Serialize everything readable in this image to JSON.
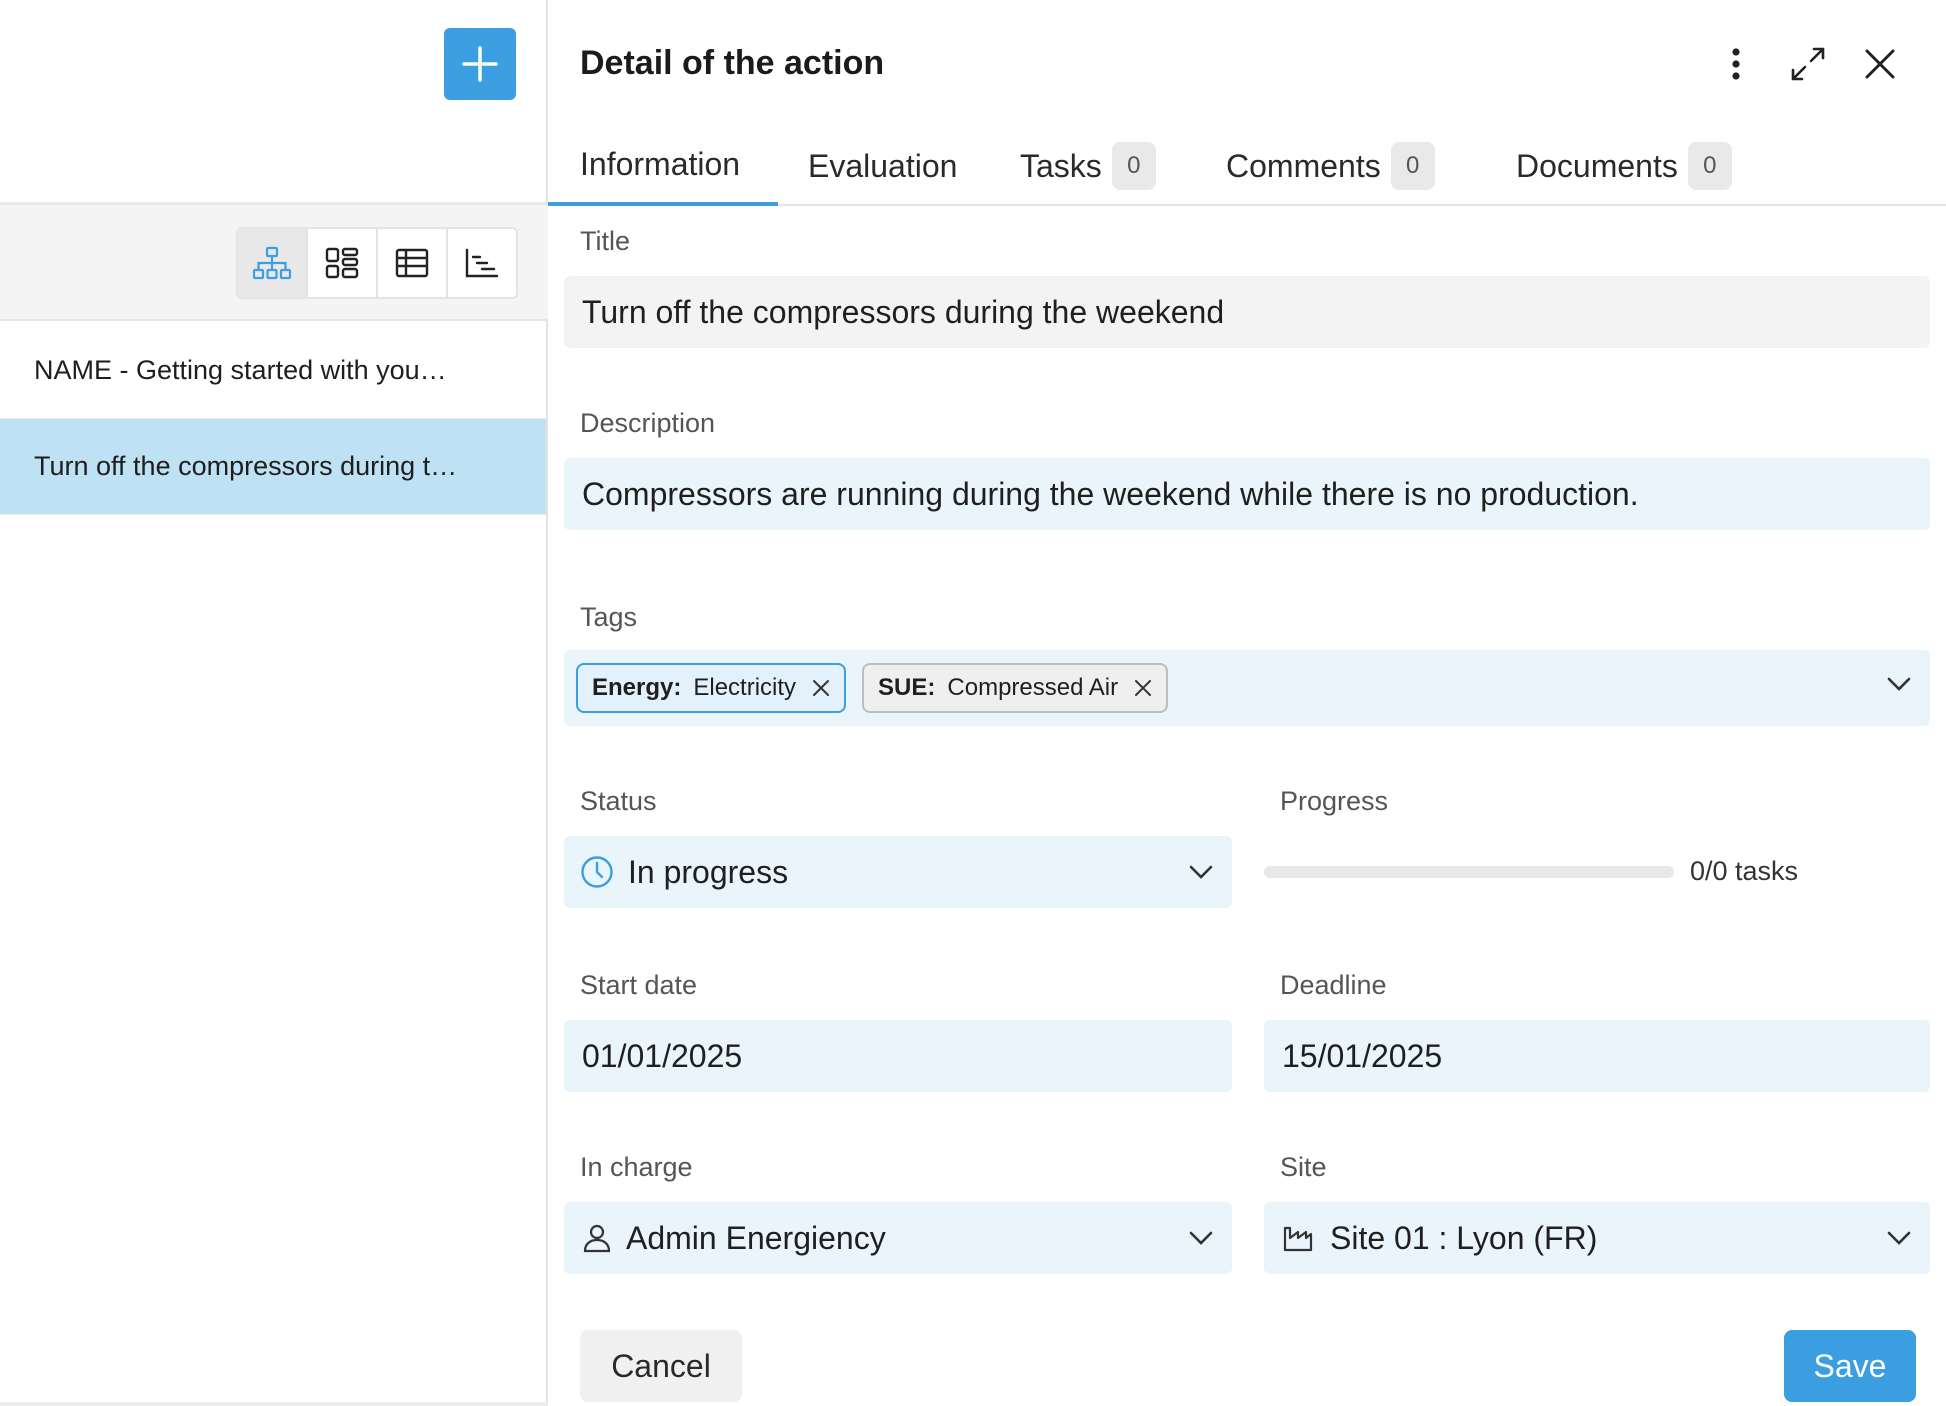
{
  "left": {
    "add_button_icon": "plus-icon",
    "view_modes": [
      "tree-view-icon",
      "cards-view-icon",
      "table-view-icon",
      "gantt-view-icon"
    ],
    "actions": [
      {
        "label": "NAME - Getting started with you…"
      },
      {
        "label": "Turn off the compressors during t…",
        "selected": true
      }
    ]
  },
  "panel": {
    "title": "Detail of the action",
    "tabs": [
      {
        "label": "Information"
      },
      {
        "label": "Evaluation"
      },
      {
        "label": "Tasks",
        "count": "0"
      },
      {
        "label": "Comments",
        "count": "0"
      },
      {
        "label": "Documents",
        "count": "0"
      }
    ],
    "form": {
      "title_label": "Title",
      "title_value": "Turn off the compressors during the weekend",
      "description_label": "Description",
      "description_value": "Compressors are running during the weekend while there is no production.",
      "tags_label": "Tags",
      "tags": [
        {
          "key": "Energy:",
          "value": "Electricity"
        },
        {
          "key": "SUE:",
          "value": "Compressed Air"
        }
      ],
      "status_label": "Status",
      "status_value": "In progress",
      "progress_label": "Progress",
      "progress_text": "0/0 tasks",
      "progress_fraction": 0,
      "start_label": "Start date",
      "start_value": "01/01/2025",
      "deadline_label": "Deadline",
      "deadline_value": "15/01/2025",
      "in_charge_label": "In charge",
      "in_charge_value": "Admin Energiency",
      "site_label": "Site",
      "site_value": "Site 01 : Lyon (FR)"
    },
    "buttons": {
      "cancel": "Cancel",
      "save": "Save"
    }
  },
  "colors": {
    "accent": "#3a9ee0",
    "field_bg": "#e9f4fb",
    "selected_row": "#bfe1f4"
  }
}
